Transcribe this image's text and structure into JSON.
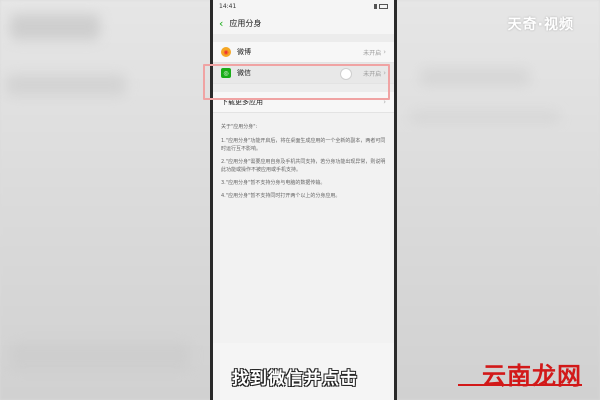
{
  "statusbar": {
    "time": "14:41"
  },
  "header": {
    "back_icon": "chevron-left-icon",
    "title": "应用分身"
  },
  "apps": [
    {
      "name": "微博",
      "status": "未开启",
      "icon": "weibo-icon"
    },
    {
      "name": "微信",
      "status": "未开启",
      "icon": "wechat-icon"
    }
  ],
  "download_more": {
    "label": "下载更多应用"
  },
  "about": {
    "title": "关于\"应用分身\":",
    "items": [
      "1.\"应用分身\"功能开启后，将在桌面生成应用的一个全新的副本，两者可同时运行互不影响。",
      "2.\"应用分身\"需要应用自身及手机共同支持，若分身功能出现异常，则说明此功能或操作不被应用或手机支持。",
      "3.\"应用分身\"暂不支持分身与电脑的数据传输。",
      "4.\"应用分身\"暂不支持同时打开两个以上的分身应用。"
    ]
  },
  "watermark": "天奇·视频",
  "caption": "找到微信并点击",
  "logo": "云南龙网",
  "colors": {
    "accent": "#1aad19",
    "highlight": "#f0a3a3",
    "logo": "#d21919"
  }
}
